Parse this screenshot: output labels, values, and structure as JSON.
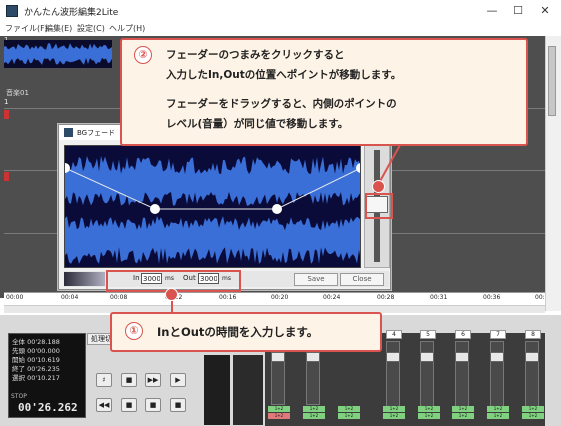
{
  "window": {
    "title": "かんたん波形編集2Lite",
    "minimize_icon": "—",
    "maximize_icon": "☐",
    "close_icon": "✕"
  },
  "menu": [
    "ファイル(F)",
    "編集(E)",
    "設定(C)",
    "ヘルプ(H)"
  ],
  "track": {
    "number_top": "1",
    "label": "音楽01",
    "number_mid": "1"
  },
  "ruler": {
    "ticks": [
      "00:00",
      "00:04",
      "00:08",
      "00:12",
      "00:16",
      "00:20",
      "00:24",
      "00:28",
      "00:31",
      "00:36",
      "00:"
    ]
  },
  "dialog": {
    "title": "BGフェード",
    "in_label": "In",
    "in_value": "3000",
    "in_unit": "ms",
    "out_label": "Out",
    "out_value": "3000",
    "out_unit": "ms",
    "save_label": "Save",
    "close_label": "Close"
  },
  "callout2": {
    "number": "②",
    "line1": "フェーダーのつまみをクリックすると",
    "line2": "入力したIn,Outの位置へポイントが移動します。",
    "line3": "フェーダーをドラッグすると、内側のポイントの",
    "line4": "レベル(音量）が同じ値で移動します。"
  },
  "callout1": {
    "number": "①",
    "text": "InとOutの時間を入力します。"
  },
  "status": {
    "rows": [
      {
        "label": "全体",
        "value": "00'28.188"
      },
      {
        "label": "先頭",
        "value": "00'00.000"
      },
      {
        "label": "開始",
        "value": "00'10.619"
      },
      {
        "label": "終了",
        "value": "00'26.235"
      },
      {
        "label": "選択",
        "value": "00'10.217"
      }
    ],
    "state": "STOP",
    "time": "00'26.262"
  },
  "process_label": "処理切",
  "transport": {
    "row1": [
      "♯",
      "■",
      "▶▶",
      "▶"
    ],
    "row2": [
      "◀◀",
      "■",
      "■",
      "■"
    ]
  },
  "mixer": {
    "channels": [
      "4",
      "5",
      "6",
      "7",
      "8"
    ],
    "btn_top": "1+2",
    "btn_bottom": "1+2"
  },
  "colors": {
    "callout_border": "#d9534f",
    "callout_bg": "#fdf3e6",
    "wave": "#3a6fd8",
    "workspace": "#4e4e4e"
  }
}
